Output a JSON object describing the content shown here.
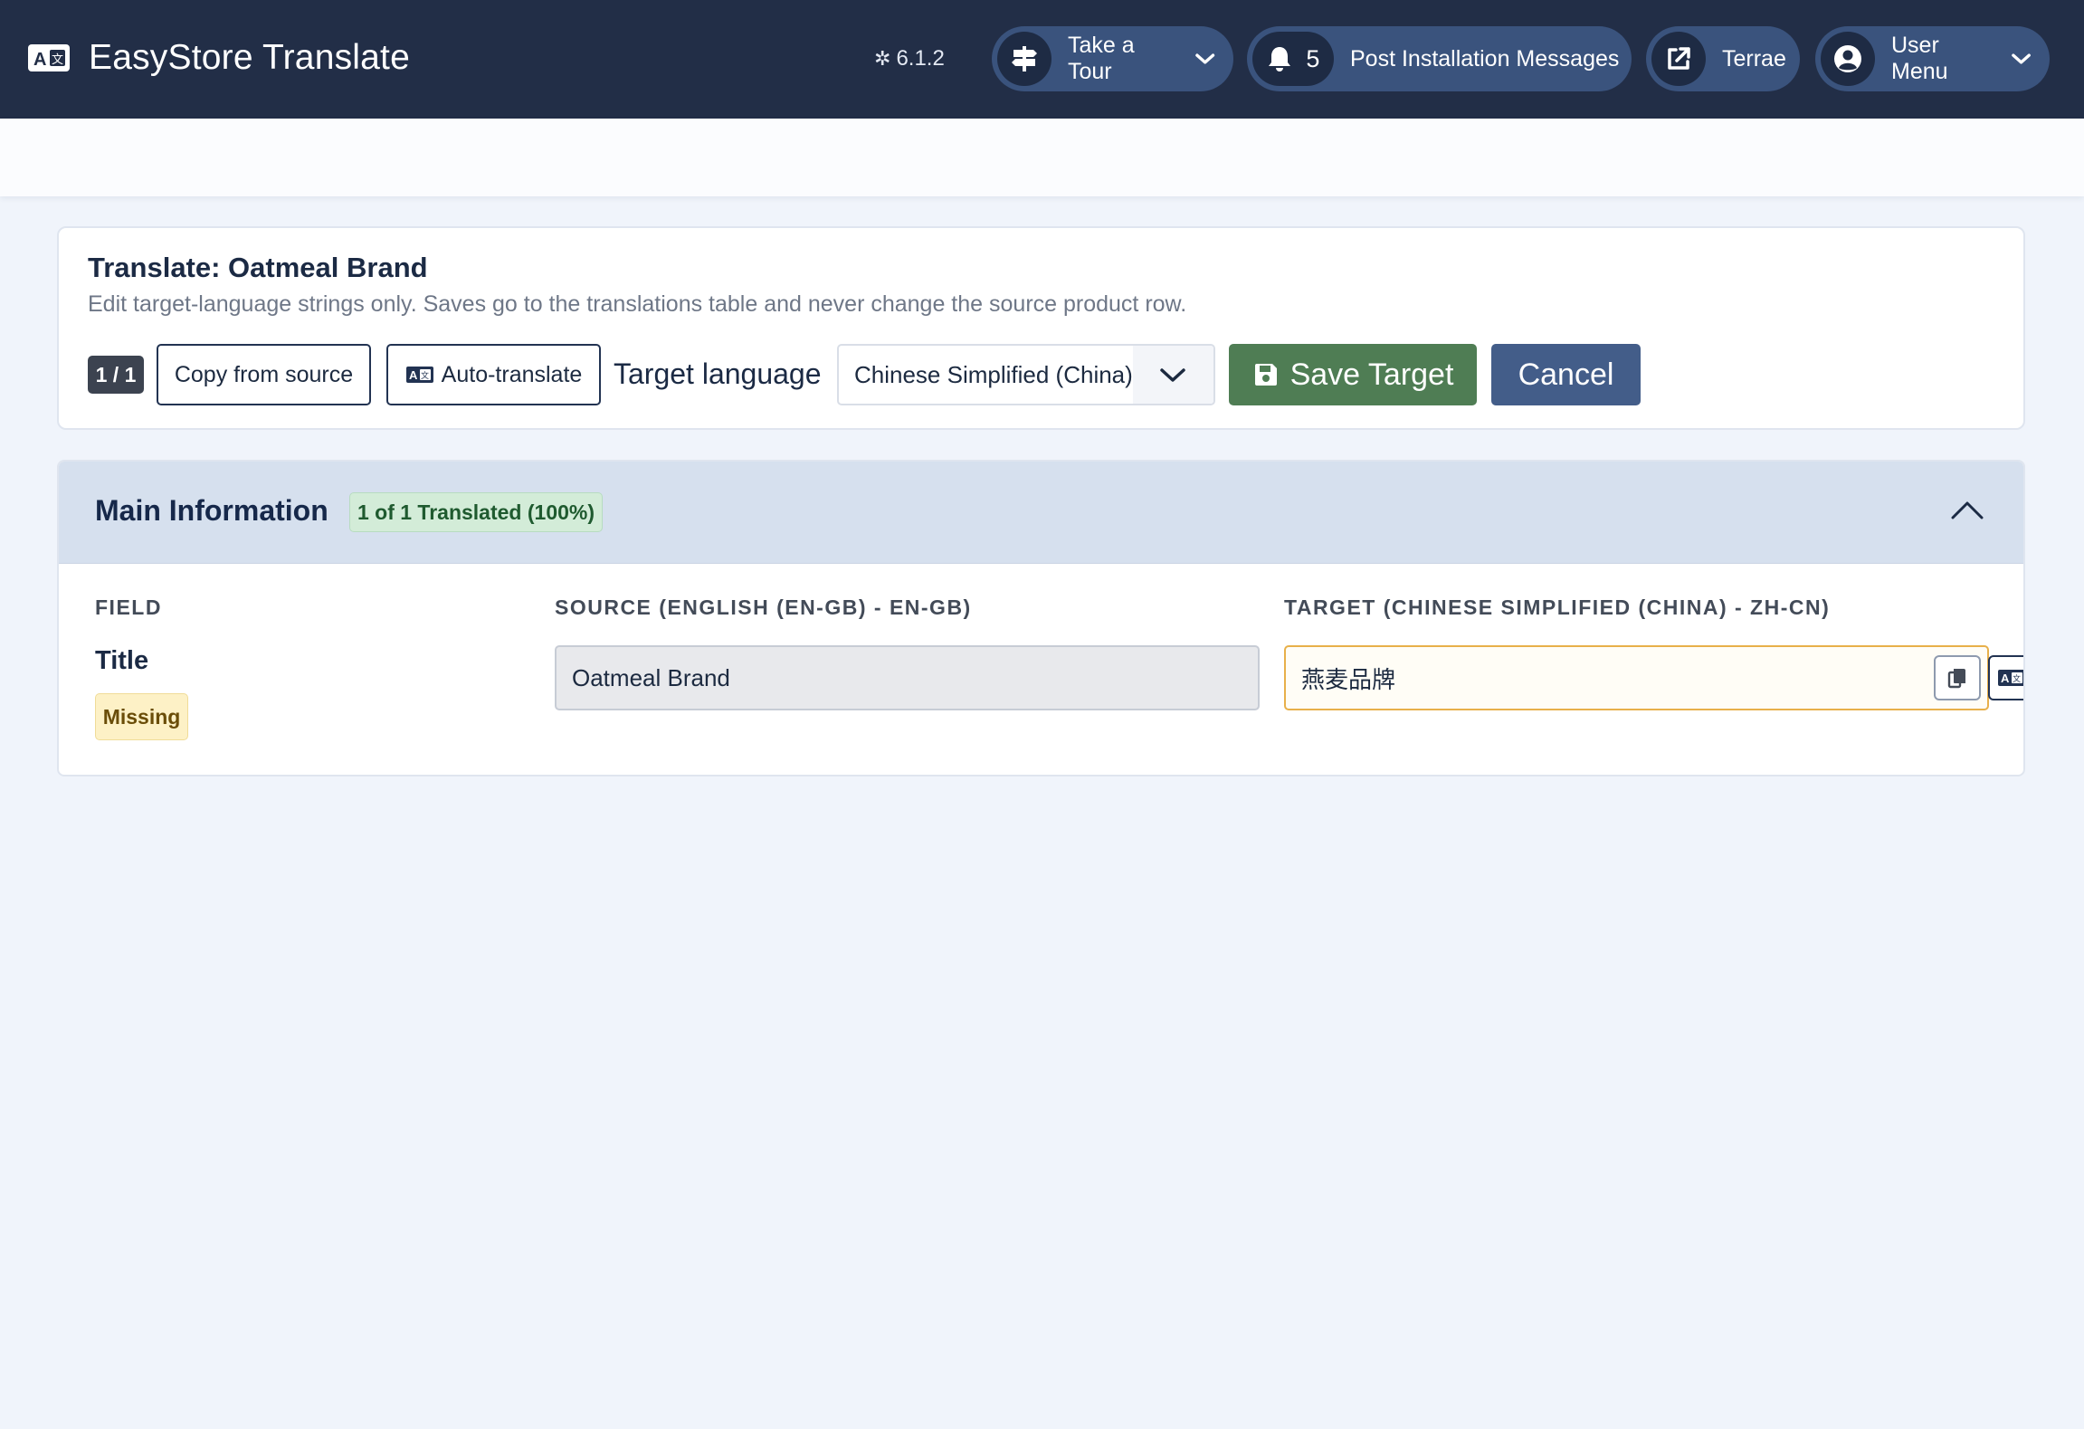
{
  "header": {
    "app_title": "EasyStore Translate",
    "version": "6.1.2",
    "tour_label": "Take a Tour",
    "messages_count": "5",
    "messages_label": "Post Installation Messages",
    "site_label": "Terrae",
    "user_label": "User Menu"
  },
  "card": {
    "title": "Translate: Oatmeal Brand",
    "description": "Edit target-language strings only. Saves go to the translations table and never change the source product row.",
    "counter": "1 / 1",
    "copy_label": "Copy from source",
    "auto_label": "Auto-translate",
    "target_language_label": "Target language",
    "target_language_value": "Chinese Simplified (China)",
    "save_label": "Save Target",
    "cancel_label": "Cancel"
  },
  "section": {
    "title": "Main Information",
    "badge": "1 of 1 Translated (100%)",
    "columns": {
      "field": "FIELD",
      "source": "SOURCE (ENGLISH (EN-GB) - EN-GB)",
      "target": "TARGET (CHINESE SIMPLIFIED (CHINA) - ZH-CN)"
    },
    "rows": [
      {
        "field": "Title",
        "status": "Missing",
        "source_value": "Oatmeal Brand",
        "target_value": "燕麦品牌"
      }
    ]
  },
  "colors": {
    "header_bg": "#222e47",
    "pill_bg": "#3a537d",
    "save_green": "#4f7d54",
    "cancel_blue": "#435d89",
    "section_head_bg": "#d6e0ee",
    "target_border": "#e8b04a"
  },
  "icons": {
    "brand": "translate-icon",
    "version": "joomla-icon",
    "tour": "signpost-icon",
    "messages": "bell-icon",
    "site": "external-link-icon",
    "user": "user-circle-icon",
    "save": "floppy-disk-icon",
    "collapse": "chevron-up-icon",
    "copy": "copy-icon",
    "auto": "translate-icon"
  }
}
